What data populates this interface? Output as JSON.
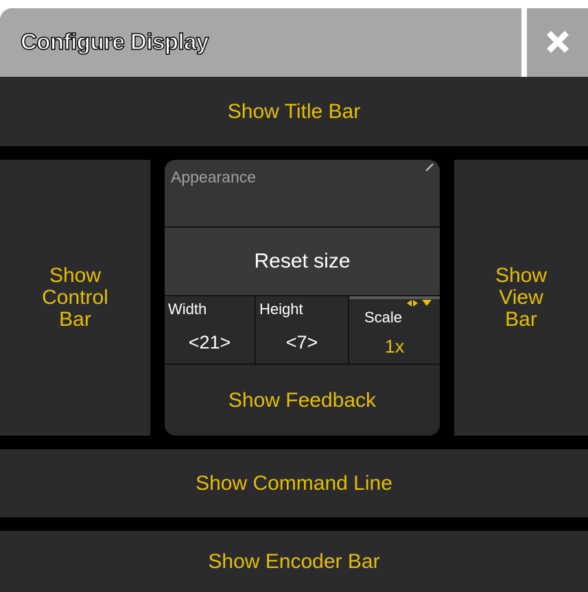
{
  "dialog": {
    "title": "Configure Display",
    "close_icon": "close-icon"
  },
  "buttons": {
    "show_title_bar": "Show Title Bar",
    "show_control_bar": "Show Control Bar",
    "show_view_bar": "Show View Bar",
    "show_command_line": "Show Command Line",
    "show_encoder_bar": "Show Encoder Bar"
  },
  "center": {
    "appearance_label": "Appearance",
    "reset_size": "Reset size",
    "width_label": "Width",
    "width_value": "<21>",
    "height_label": "Height",
    "height_value": "<7>",
    "scale_label": "Scale",
    "scale_value": "1x",
    "show_feedback": "Show Feedback"
  },
  "colors": {
    "accent": "#e5bf00",
    "button_bg": "#2b2b2d",
    "titlebar_bg": "#a7a7a7"
  }
}
